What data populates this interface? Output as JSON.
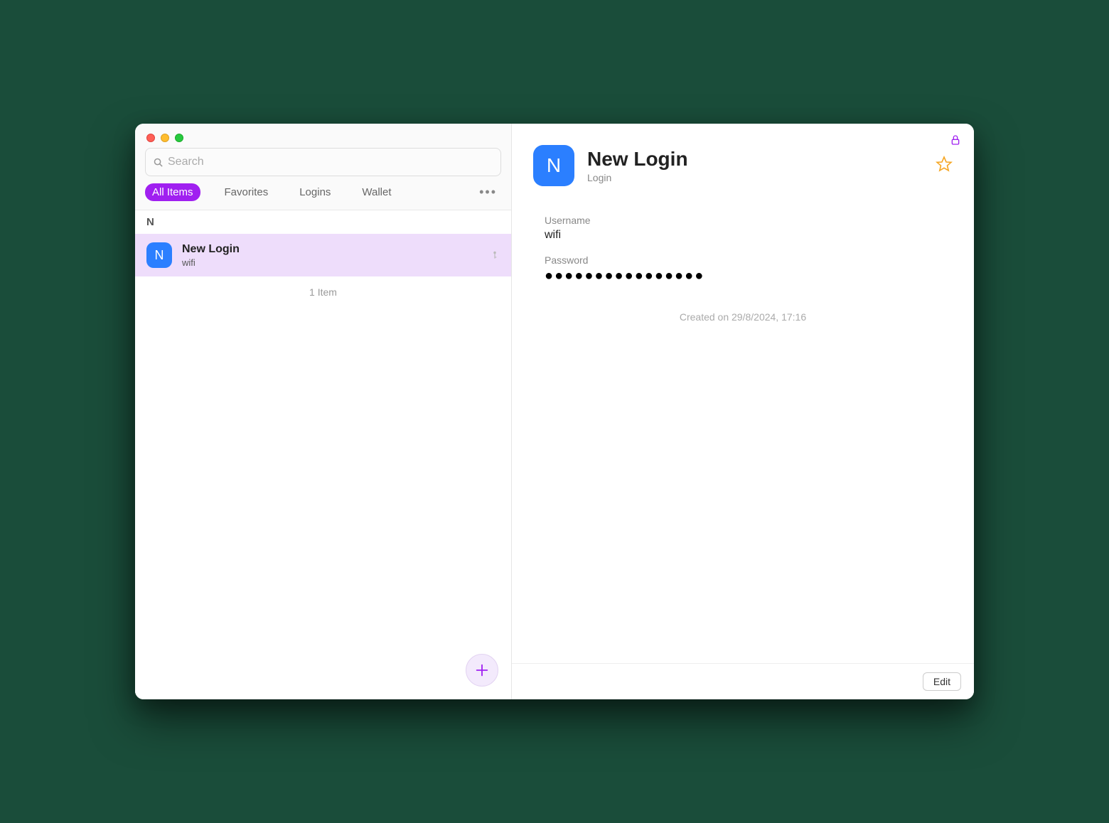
{
  "search": {
    "placeholder": "Search"
  },
  "tabs": {
    "all_items": "All Items",
    "favorites": "Favorites",
    "logins": "Logins",
    "wallet": "Wallet"
  },
  "list": {
    "section_letter": "N",
    "item": {
      "avatar_letter": "N",
      "title": "New Login",
      "subtitle": "wifi"
    },
    "footer": "1 Item"
  },
  "detail": {
    "avatar_letter": "N",
    "title": "New Login",
    "type": "Login",
    "username_label": "Username",
    "username_value": "wifi",
    "password_label": "Password",
    "password_value": "●●●●●●●●●●●●●●●●",
    "created_text": "Created on 29/8/2024, 17:16",
    "edit_label": "Edit"
  }
}
